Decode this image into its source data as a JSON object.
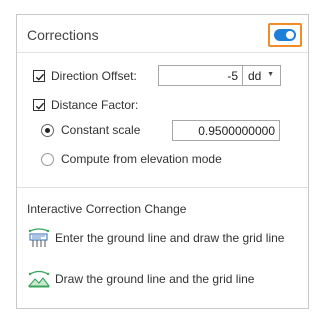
{
  "panel": {
    "title": "Corrections",
    "toggle_on": true
  },
  "direction_offset": {
    "checked": true,
    "label": "Direction Offset:",
    "value": "-5",
    "unit": "dd"
  },
  "distance_factor": {
    "checked": true,
    "label": "Distance Factor:",
    "options": [
      {
        "label": "Constant scale",
        "selected": true,
        "value": "0.9500000000"
      },
      {
        "label": "Compute from elevation mode",
        "selected": false
      }
    ]
  },
  "interactive": {
    "section_title": "Interactive Correction Change",
    "actions": [
      {
        "label": "Enter the ground line and draw the grid line",
        "icon": "ground-line-entry-icon"
      },
      {
        "label": "Draw the ground line and the grid line",
        "icon": "draw-lines-icon"
      }
    ]
  },
  "colors": {
    "accent": "#1d7fd8",
    "focus_outline": "#f28c28",
    "icon_green": "#3aa35b",
    "icon_blue": "#2f6fb5"
  }
}
